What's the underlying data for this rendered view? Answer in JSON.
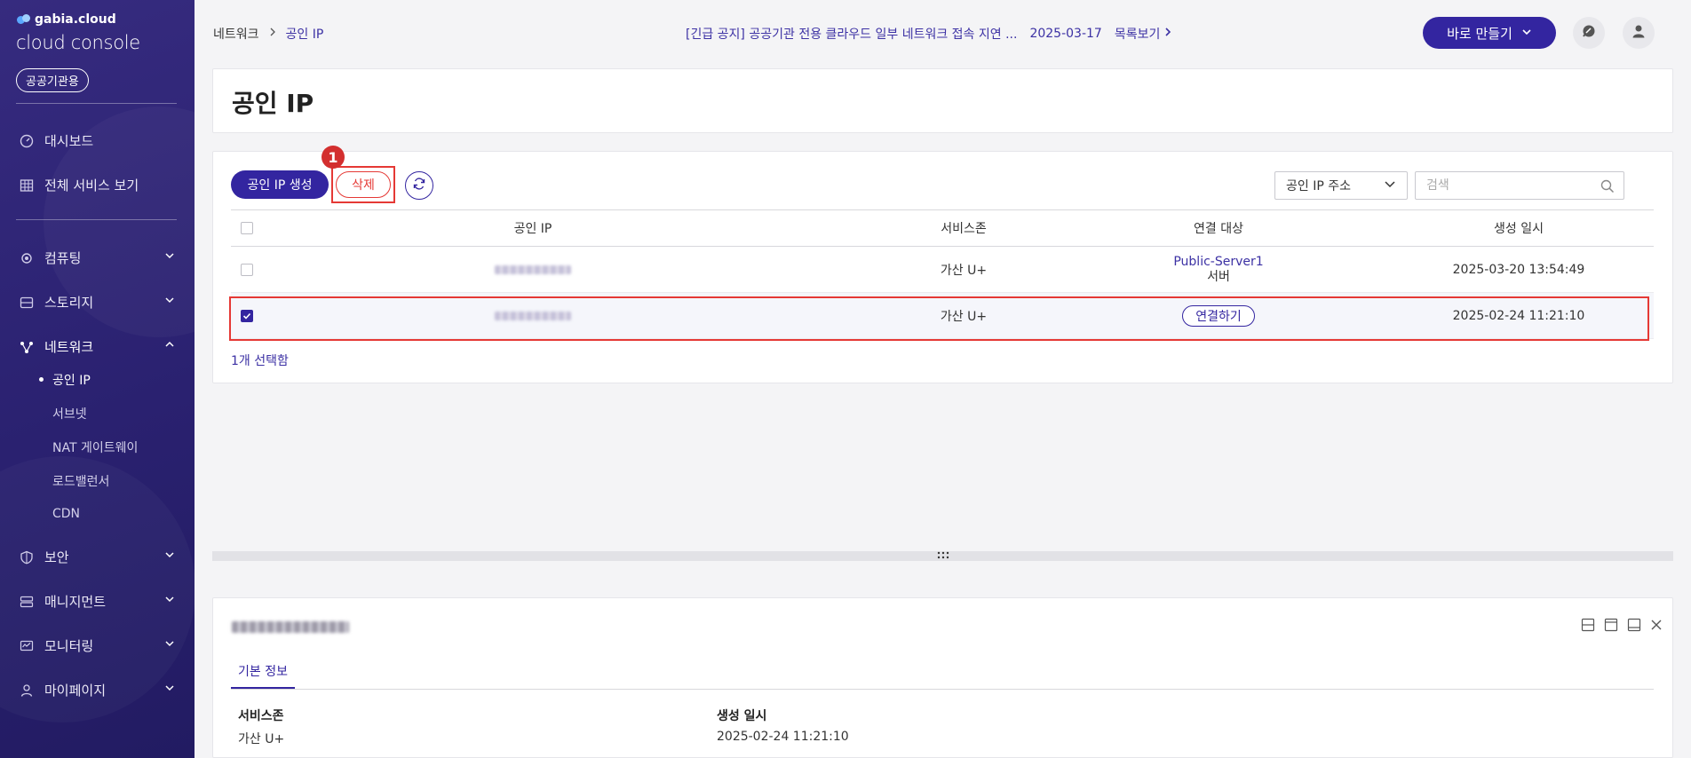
{
  "brand": {
    "top": "gabia.cloud",
    "sub": "cloud console",
    "org_badge": "공공기관용"
  },
  "sidebar": {
    "top_items": [
      {
        "label": "대시보드",
        "icon": "dashboard-icon"
      },
      {
        "label": "전체 서비스 보기",
        "icon": "grid-icon"
      }
    ],
    "sections": [
      {
        "label": "컴퓨팅",
        "icon": "cpu-icon",
        "expanded": false
      },
      {
        "label": "스토리지",
        "icon": "storage-icon",
        "expanded": false
      },
      {
        "label": "네트워크",
        "icon": "network-icon",
        "expanded": true
      },
      {
        "label": "보안",
        "icon": "shield-icon",
        "expanded": false
      },
      {
        "label": "매니지먼트",
        "icon": "management-icon",
        "expanded": false
      },
      {
        "label": "모니터링",
        "icon": "monitor-icon",
        "expanded": false
      },
      {
        "label": "마이페이지",
        "icon": "user-icon",
        "expanded": false
      }
    ],
    "network_sub": [
      "공인 IP",
      "서브넷",
      "NAT 게이트웨이",
      "로드밸런서",
      "CDN"
    ]
  },
  "header": {
    "breadcrumb": [
      "네트워크",
      "공인 IP"
    ],
    "notice_text": "[긴급 공지] 공공기관 전용 클라우드 일부 네트워크 접속 지연 ...",
    "notice_date": "2025-03-17",
    "notice_link": "목록보기",
    "create_button": "바로 만들기"
  },
  "page": {
    "title": "공인 IP"
  },
  "toolbar": {
    "create_label": "공인 IP 생성",
    "delete_label": "삭제",
    "step_badge": "1",
    "filter_select": "공인 IP 주소",
    "search_placeholder": "검색"
  },
  "table": {
    "columns": [
      "공인 IP",
      "서비스존",
      "연결 대상",
      "생성 일시"
    ],
    "rows": [
      {
        "checked": false,
        "zone": "가산 U+",
        "target_name": "Public-Server1",
        "target_type": "서버",
        "created": "2025-03-20 13:54:49"
      },
      {
        "checked": true,
        "zone": "가산 U+",
        "target_action": "연결하기",
        "created": "2025-02-24 11:21:10"
      }
    ],
    "selected_count": "1개 선택함"
  },
  "detail": {
    "tab": "기본 정보",
    "fields": [
      {
        "label": "서비스존",
        "value": "가산 U+"
      },
      {
        "label": "생성 일시",
        "value": "2025-02-24 11:21:10"
      }
    ]
  },
  "colors": {
    "brand": "#3325a0",
    "sidebar": "#2a2170",
    "highlight": "#e53935"
  }
}
